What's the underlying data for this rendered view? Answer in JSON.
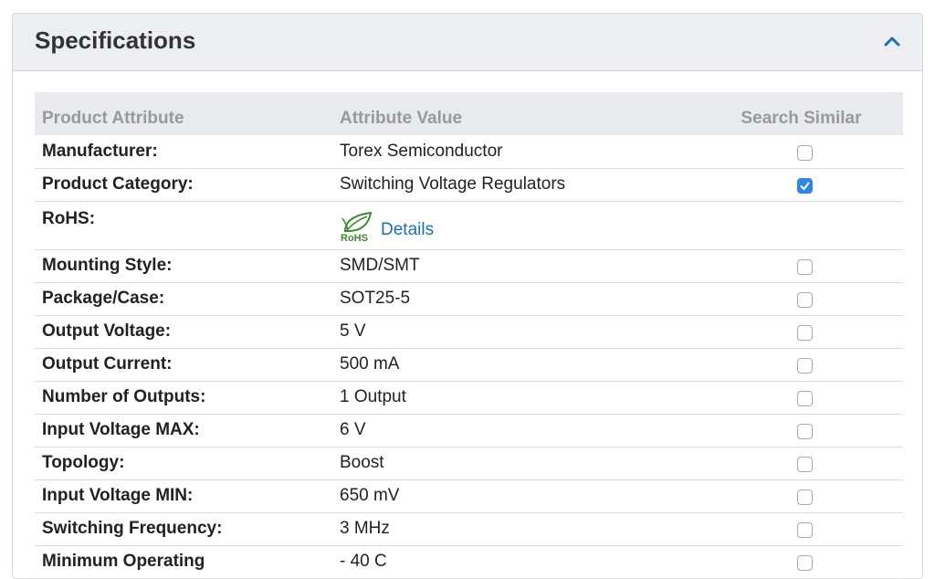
{
  "panel": {
    "title": "Specifications"
  },
  "table": {
    "headers": {
      "attribute": "Product Attribute",
      "value": "Attribute Value",
      "similar": "Search Similar"
    },
    "rows": [
      {
        "attribute": "Manufacturer:",
        "value": "Torex Semiconductor",
        "checked": false
      },
      {
        "attribute": "Product Category:",
        "value": "Switching Voltage Regulators",
        "checked": true
      },
      {
        "attribute": "RoHS:",
        "rohs_logo_text": "RoHS",
        "link": "Details"
      },
      {
        "attribute": "Mounting Style:",
        "value": "SMD/SMT",
        "checked": false
      },
      {
        "attribute": "Package/Case:",
        "value": "SOT25-5",
        "checked": false
      },
      {
        "attribute": "Output Voltage:",
        "value": "5 V",
        "checked": false
      },
      {
        "attribute": "Output Current:",
        "value": "500 mA",
        "checked": false
      },
      {
        "attribute": "Number of Outputs:",
        "value": "1 Output",
        "checked": false
      },
      {
        "attribute": "Input Voltage MAX:",
        "value": "6 V",
        "checked": false
      },
      {
        "attribute": "Topology:",
        "value": "Boost",
        "checked": false
      },
      {
        "attribute": "Input Voltage MIN:",
        "value": "650 mV",
        "checked": false
      },
      {
        "attribute": "Switching Frequency:",
        "value": "3 MHz",
        "checked": false
      },
      {
        "attribute": "Minimum Operating",
        "value": "- 40 C",
        "checked": false
      }
    ]
  },
  "icons": {
    "collapse": "chevron-up-icon",
    "rohs": "rohs-leaf-icon",
    "check": "checkmark-icon"
  },
  "colors": {
    "accent": "#1a6fb4",
    "checkbox_checked": "#2f86e8",
    "header_bg": "#eceef1",
    "rohs_green": "#3a8a2e"
  }
}
